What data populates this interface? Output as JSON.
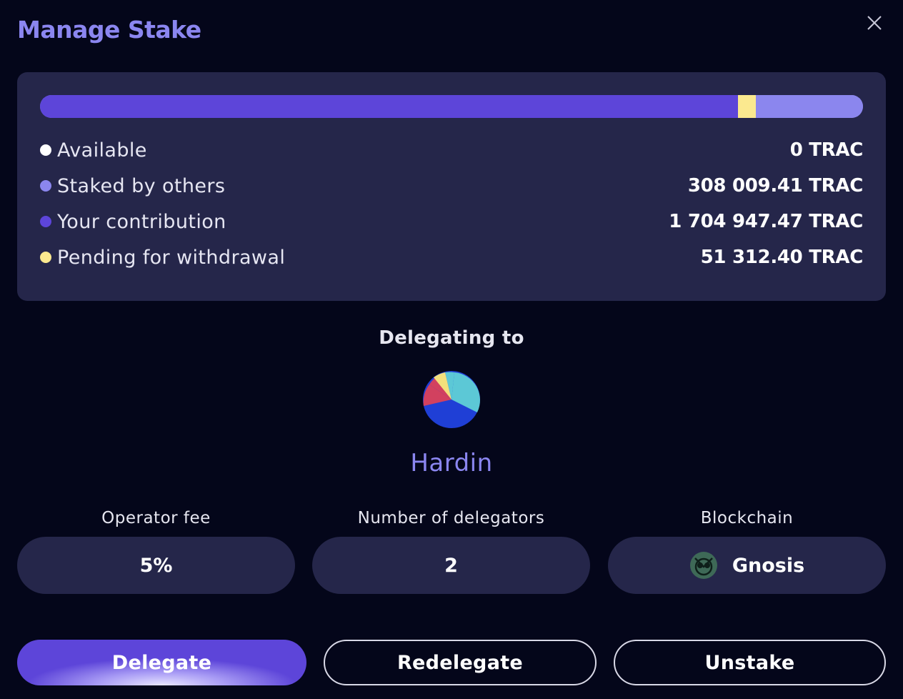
{
  "modal": {
    "title": "Manage Stake"
  },
  "stake": {
    "bar": {
      "contribution_fraction": 0.8485,
      "pending_fraction": 0.0212,
      "others_fraction": 0.1303
    },
    "rows": [
      {
        "label": "Available",
        "value": "0 TRAC",
        "color": "#ffffff"
      },
      {
        "label": "Staked by others",
        "value": "308 009.41 TRAC",
        "color": "#8b86ee"
      },
      {
        "label": "Your contribution",
        "value": "1 704 947.47 TRAC",
        "color": "#5d45d9"
      },
      {
        "label": "Pending for withdrawal",
        "value": "51 312.40 TRAC",
        "color": "#fbe98f"
      }
    ]
  },
  "delegation": {
    "heading": "Delegating to",
    "operator_name": "Hardin"
  },
  "info": {
    "operator_fee": {
      "label": "Operator fee",
      "value": "5%"
    },
    "delegators": {
      "label": "Number of delegators",
      "value": "2"
    },
    "blockchain": {
      "label": "Blockchain",
      "value": "Gnosis",
      "icon": "gnosis-icon"
    }
  },
  "actions": {
    "delegate": "Delegate",
    "redelegate": "Redelegate",
    "unstake": "Unstake"
  },
  "colors": {
    "accent": "#8b86f0",
    "primary": "#5d45d9",
    "card": "#25264a",
    "background": "#04061a",
    "pending": "#fbe98f"
  }
}
